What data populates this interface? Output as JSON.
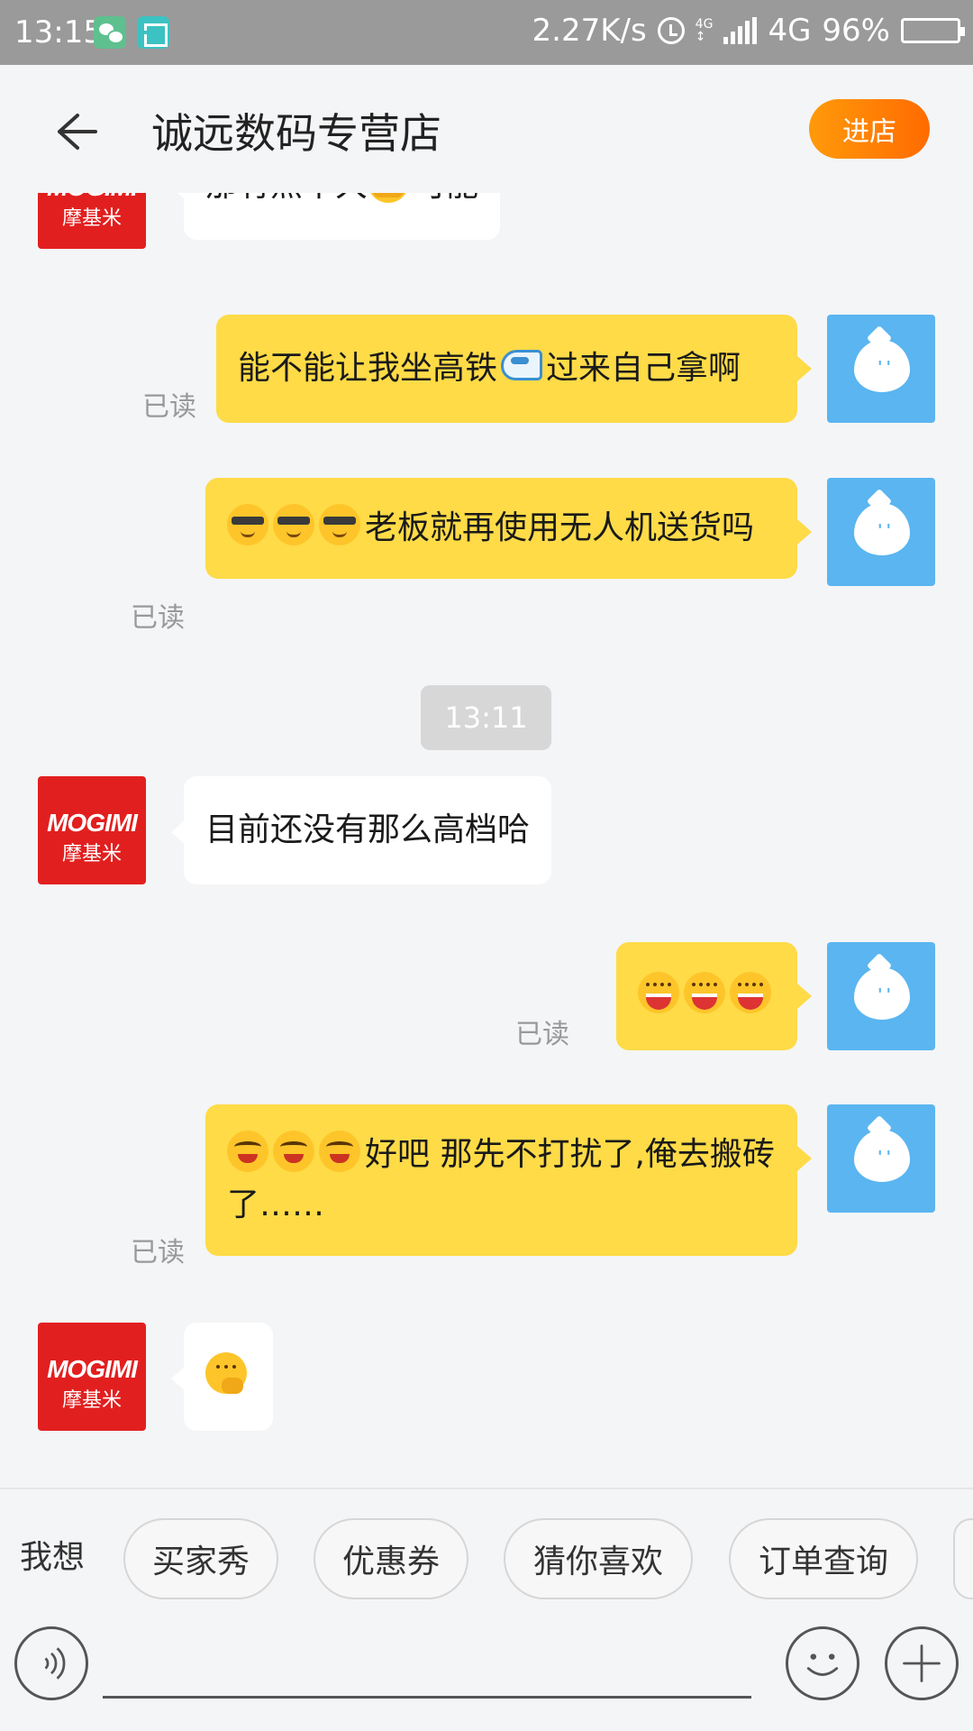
{
  "status_bar": {
    "time": "13:15",
    "net_speed": "2.27K/s",
    "network": "4G",
    "battery": "96%",
    "battery_level": 0.96
  },
  "nav": {
    "title": "诚远数码专营店",
    "enter_store": "进店"
  },
  "avatar_shop": {
    "brand_en": "MOGIMI",
    "brand_cn": "摩基米"
  },
  "messages": {
    "m1_text": "那有点不大",
    "m1_tail": "可能",
    "m2_a": "能不能让我坐高铁",
    "m2_b": "过来自己拿啊",
    "m3_text": "老板就再使用无人机送货吗",
    "timestamp": "13:11",
    "m4_text": "目前还没有那么高档哈",
    "m6_text": "好吧   那先不打扰了,俺去搬砖了……"
  },
  "read_label": "已读",
  "quick_bar": {
    "label": "我想",
    "chips": [
      "买家秀",
      "优惠券",
      "猜你喜欢",
      "订单查询"
    ]
  },
  "icons": [
    "back-arrow-icon",
    "voice-icon",
    "emoji-icon",
    "plus-icon"
  ],
  "colors": {
    "accent": "#ff8a00",
    "my_bubble": "#fedb47",
    "shop_avatar": "#e21f1f",
    "my_avatar": "#5ab5f0"
  }
}
